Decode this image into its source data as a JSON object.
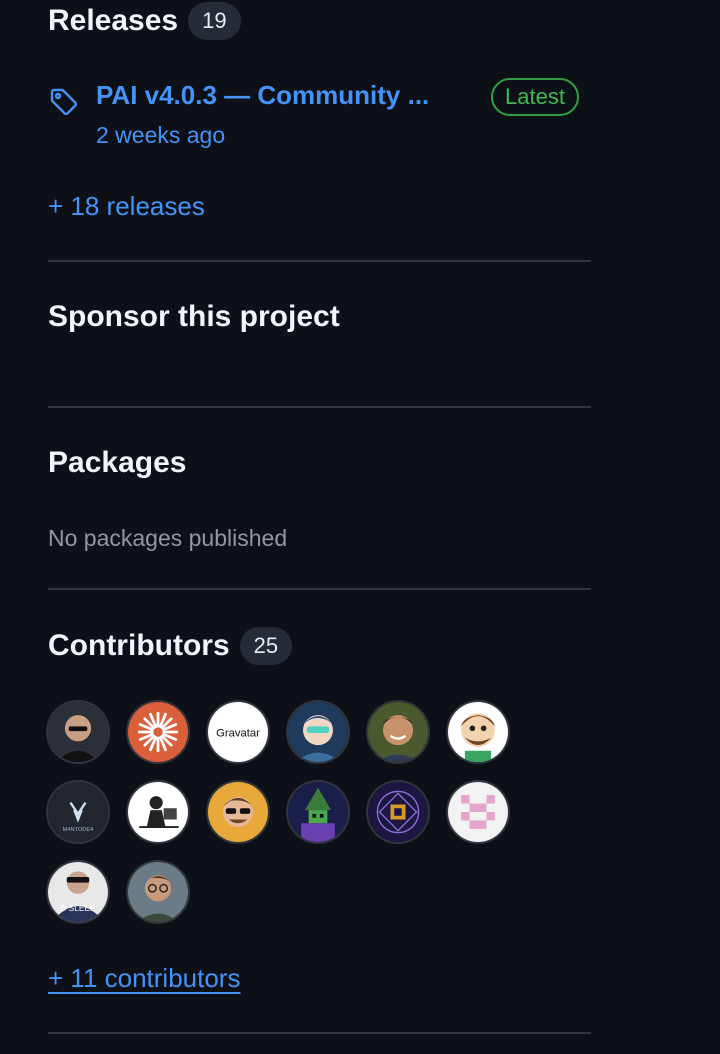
{
  "releases": {
    "title": "Releases",
    "count": "19",
    "latest": {
      "name": "PAI v4.0.3 — Community ...",
      "date": "2 weeks ago",
      "badge": "Latest"
    },
    "more_link": "+ 18 releases"
  },
  "sponsor": {
    "title": "Sponsor this project"
  },
  "packages": {
    "title": "Packages",
    "empty_text": "No packages published"
  },
  "contributors": {
    "title": "Contributors",
    "count": "25",
    "avatars": [
      {
        "name": "bald-man-avatar"
      },
      {
        "name": "orange-starburst-avatar"
      },
      {
        "name": "gravatar-avatar",
        "text": "Gravatar"
      },
      {
        "name": "anime-character-avatar"
      },
      {
        "name": "smiling-man-avatar"
      },
      {
        "name": "cartoon-man-avatar"
      },
      {
        "name": "m4ntode4-logo-avatar",
        "text": "M4NTODE4"
      },
      {
        "name": "sketch-desk-avatar"
      },
      {
        "name": "sunglasses-cartoon-avatar"
      },
      {
        "name": "wizard-pixel-avatar"
      },
      {
        "name": "geometric-mandala-avatar"
      },
      {
        "name": "pink-identicon-avatar"
      },
      {
        "name": "sleep-shirt-avatar",
        "text": "D SLEEP"
      },
      {
        "name": "man-glasses-avatar"
      }
    ],
    "more_link": "+ 11 contributors"
  },
  "colors": {
    "background": "#0d1117",
    "link": "#4493f8",
    "latest_green": "#3fb950",
    "muted": "#9198a1"
  }
}
